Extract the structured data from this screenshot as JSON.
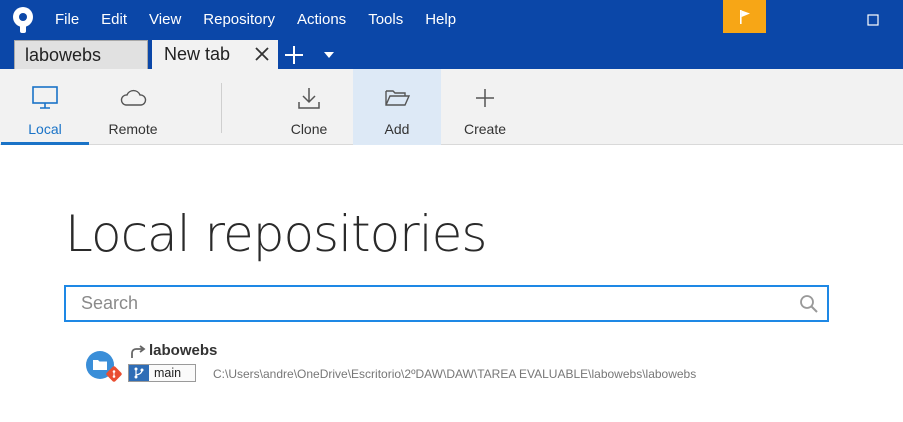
{
  "menu": [
    "File",
    "Edit",
    "View",
    "Repository",
    "Actions",
    "Tools",
    "Help"
  ],
  "tabs": [
    {
      "label": "labowebs",
      "active": false
    },
    {
      "label": "New tab",
      "active": true
    }
  ],
  "toolbar": {
    "local": "Local",
    "remote": "Remote",
    "clone": "Clone",
    "add": "Add",
    "create": "Create"
  },
  "page": {
    "title": "Local repositories"
  },
  "search": {
    "placeholder": "Search",
    "value": ""
  },
  "repositories": [
    {
      "name": "labowebs",
      "branch": "main",
      "path": "C:\\Users\\andre\\OneDrive\\Escritorio\\2ºDAW\\DAW\\TAREA EVALUABLE\\labowebs\\labowebs"
    }
  ],
  "colors": {
    "titlebar": "#0b47a8",
    "flag": "#f7a616",
    "accent": "#1e88e5",
    "branch": "#2f6db6",
    "git": "#e94e31"
  },
  "icons": {
    "app": "sourcetree-logo",
    "flag": "flag-icon",
    "local": "monitor-icon",
    "remote": "cloud-icon",
    "clone": "download-icon",
    "add": "folder-open-icon",
    "create": "plus-icon",
    "search": "search-icon"
  }
}
